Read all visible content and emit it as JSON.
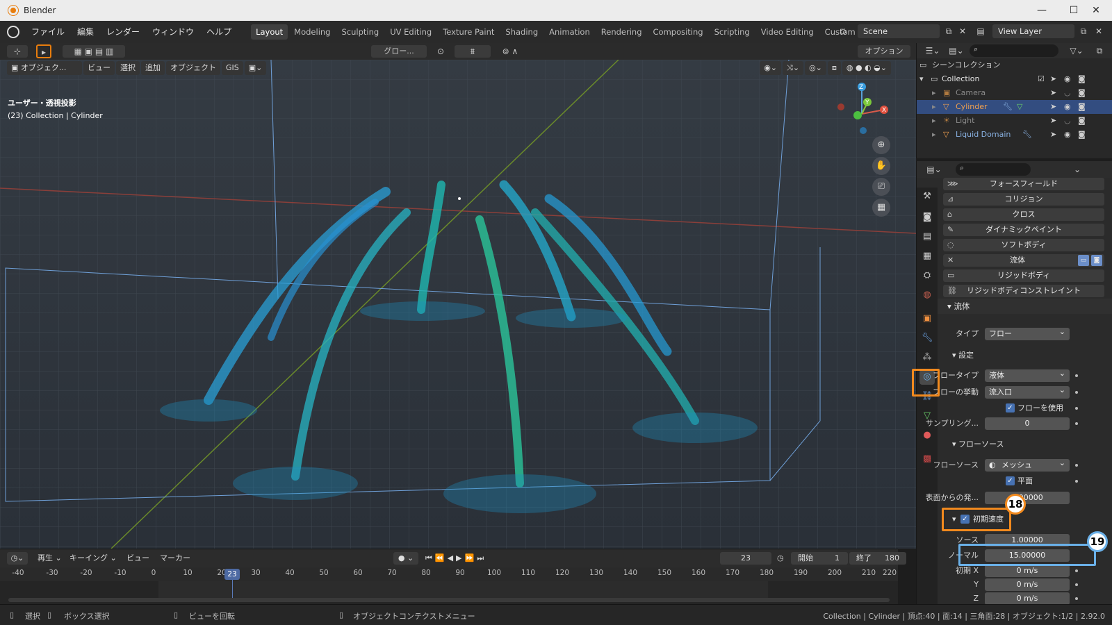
{
  "window": {
    "title": "Blender",
    "minimize": "—",
    "maximize": "☐",
    "close": "✕"
  },
  "menu": {
    "items": [
      "ファイル",
      "編集",
      "レンダー",
      "ウィンドウ",
      "ヘルプ"
    ]
  },
  "workspaces": [
    "Layout",
    "Modeling",
    "Sculpting",
    "UV Editing",
    "Texture Paint",
    "Shading",
    "Animation",
    "Rendering",
    "Compositing",
    "Scripting",
    "Video Editing",
    "Custom"
  ],
  "workspace_add": "+",
  "scene": {
    "name": "Scene",
    "view_layer": "View Layer"
  },
  "toolbar": {
    "transform_orientation": "グロー...",
    "options": "オプション"
  },
  "viewport": {
    "mode": "オブジェク...",
    "menus": [
      "ビュー",
      "選択",
      "追加",
      "オブジェクト",
      "GIS"
    ],
    "info_line1": "ユーザー・透視投影",
    "info_line2": "(23) Collection | Cylinder",
    "axis_z": "Z",
    "axis_y": "Y",
    "axis_x": "X"
  },
  "outliner": {
    "root": "シーンコレクション",
    "collection": "Collection",
    "items": [
      {
        "name": "Camera",
        "color": "#e09b5a"
      },
      {
        "name": "Cylinder",
        "color": "#f0a050"
      },
      {
        "name": "Light",
        "color": "#e09b5a"
      },
      {
        "name": "Liquid Domain",
        "color": "#f0a050"
      }
    ]
  },
  "physics_buttons": [
    "フォースフィールド",
    "コリジョン",
    "クロス",
    "ダイナミックペイント",
    "ソフトボディ",
    "流体",
    "リジッドボディ",
    "リジッドボディコンストレイント"
  ],
  "fluid_panel": {
    "title": "流体",
    "type_label": "タイプ",
    "type_value": "フロー",
    "settings_title": "設定",
    "flow_type_label": "フロータイプ",
    "flow_type_value": "液体",
    "flow_behavior_label": "フローの挙動",
    "flow_behavior_value": "流入口",
    "use_flow_label": "フローを使用",
    "sampling_label": "サンプリング...",
    "sampling_value": "0",
    "flow_source_title": "フローソース",
    "flow_source_label": "フローソース",
    "flow_source_value": "メッシュ",
    "planar_label": "平面",
    "surface_emission_label": "表面からの発...",
    "surface_emission_value": "0.00000",
    "initial_velocity_label": "初期速度",
    "source_label": "ソース",
    "source_value": "1.00000",
    "normal_label": "ノーマル",
    "normal_value": "15.00000",
    "initial_x_label": "初期 X",
    "initial_x_value": "0 m/s",
    "y_label": "Y",
    "y_value": "0 m/s",
    "z_label": "Z",
    "z_value": "0 m/s"
  },
  "timeline": {
    "playback": "再生",
    "keying": "キーイング",
    "view": "ビュー",
    "marker": "マーカー",
    "current_frame": "23",
    "start_label": "開始",
    "start_value": "1",
    "end_label": "終了",
    "end_value": "180",
    "ticks": [
      "-40",
      "-30",
      "-20",
      "-10",
      "0",
      "10",
      "20",
      "30",
      "40",
      "50",
      "60",
      "70",
      "80",
      "90",
      "100",
      "110",
      "120",
      "130",
      "140",
      "150",
      "160",
      "170",
      "180",
      "190",
      "200",
      "210",
      "220"
    ],
    "cursor_frame": "23"
  },
  "statusbar": {
    "select": "選択",
    "box_select": "ボックス選択",
    "rotate_view": "ビューを回転",
    "context_menu": "オブジェクトコンテクストメニュー",
    "stats": "Collection | Cylinder | 頂点:40 | 面:14 | 三角面:28 | オブジェクト:1/2 | 2.92.0"
  },
  "annotations": {
    "badge18": "18",
    "badge19": "19",
    "orange": "#f28a1e",
    "blue": "#6ab0e8"
  }
}
